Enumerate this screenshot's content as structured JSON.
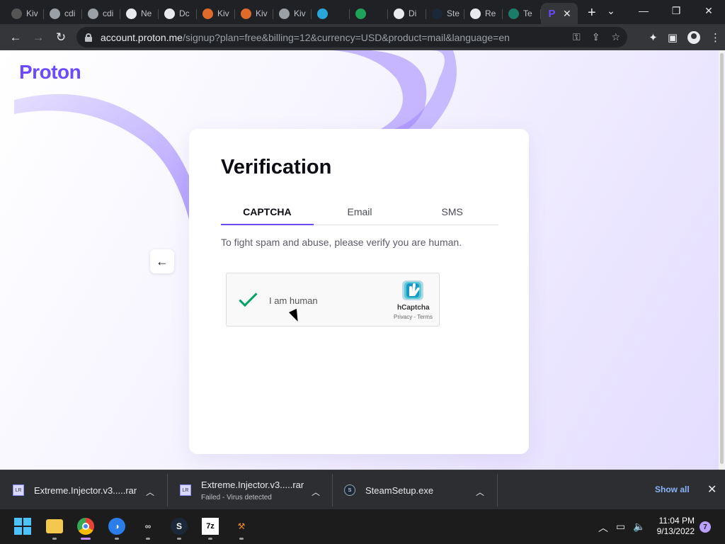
{
  "browser": {
    "tabs": [
      {
        "title": "Kiv",
        "icon": "wiki-icon",
        "color": "#555555"
      },
      {
        "title": "cdi",
        "icon": "globe-icon",
        "color": "#9aa0a6"
      },
      {
        "title": "cdi",
        "icon": "globe-icon",
        "color": "#9aa0a6"
      },
      {
        "title": "Ne",
        "icon": "chrome-icon",
        "color": "#e8eaed"
      },
      {
        "title": "Dc",
        "icon": "download-icon",
        "color": "#e8eaed"
      },
      {
        "title": "Kiv",
        "icon": "kiwi-icon",
        "color": "#e06a2c"
      },
      {
        "title": "Kiv",
        "icon": "kiwi-icon",
        "color": "#e06a2c"
      },
      {
        "title": "Kiv",
        "icon": "globe-icon",
        "color": "#9aa0a6"
      },
      {
        "title": "",
        "icon": "app-icon",
        "color": "#2aa7d9"
      },
      {
        "title": "",
        "icon": "check-app-icon",
        "color": "#1fa35b"
      },
      {
        "title": "Di",
        "icon": "roblox-icon",
        "color": "#e8eaed"
      },
      {
        "title": "Ste",
        "icon": "steam-icon",
        "color": "#1b2838"
      },
      {
        "title": "Re",
        "icon": "github-icon",
        "color": "#e8eaed"
      },
      {
        "title": "Te",
        "icon": "app-green-icon",
        "color": "#1c7c6a"
      }
    ],
    "active_tab": {
      "title": "P",
      "icon": "proton-icon",
      "color": "#6d4aff"
    },
    "new_tab_label": "+",
    "url_host": "account.proton.me",
    "url_path": "/signup?plan=free&billing=12&currency=USD&product=mail&language=en"
  },
  "page": {
    "logo": "Proton",
    "title": "Verification",
    "tabs": [
      "CAPTCHA",
      "Email",
      "SMS"
    ],
    "selected_tab": "CAPTCHA",
    "description": "To fight spam and abuse, please verify you are human.",
    "captcha": {
      "label": "I am human",
      "checked": true,
      "brand": "hCaptcha",
      "links": "Privacy - Terms"
    }
  },
  "downloads": {
    "items": [
      {
        "name": "Extreme.Injector.v3.....rar",
        "status": ""
      },
      {
        "name": "Extreme.Injector.v3.....rar",
        "status": "Failed - Virus detected"
      },
      {
        "name": "SteamSetup.exe",
        "status": ""
      }
    ],
    "show_all": "Show all"
  },
  "taskbar": {
    "time": "11:04 PM",
    "date": "9/13/2022",
    "notifications": "7"
  },
  "colors": {
    "accent": "#6d4aff",
    "captcha_check": "#00a361",
    "link": "#8ab4f8"
  }
}
